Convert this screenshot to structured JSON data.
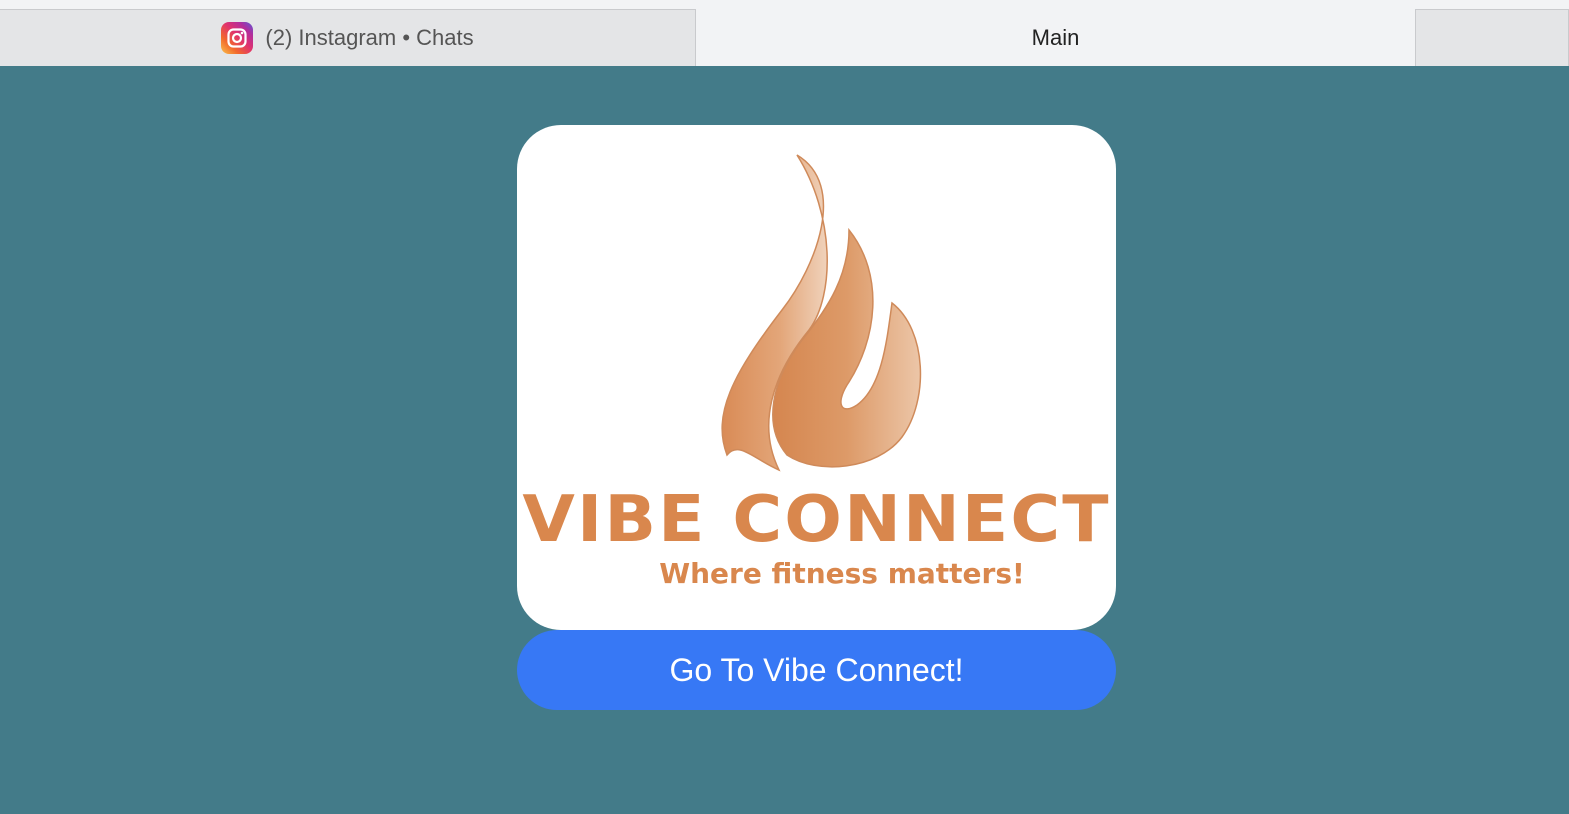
{
  "tabs": {
    "instagram": {
      "label": "(2) Instagram • Chats",
      "icon": "instagram-icon"
    },
    "main": {
      "label": "Main"
    },
    "extra": {
      "label": ""
    }
  },
  "logo": {
    "icon": "flame-icon",
    "title": "VIBE CONNECT",
    "tagline": "Where fitness matters!",
    "color": "#d9874d"
  },
  "cta": {
    "label": "Go To Vibe Connect!",
    "color": "#3778f5"
  },
  "colors": {
    "background": "#437b89",
    "tabbar": "#f2f3f5"
  }
}
